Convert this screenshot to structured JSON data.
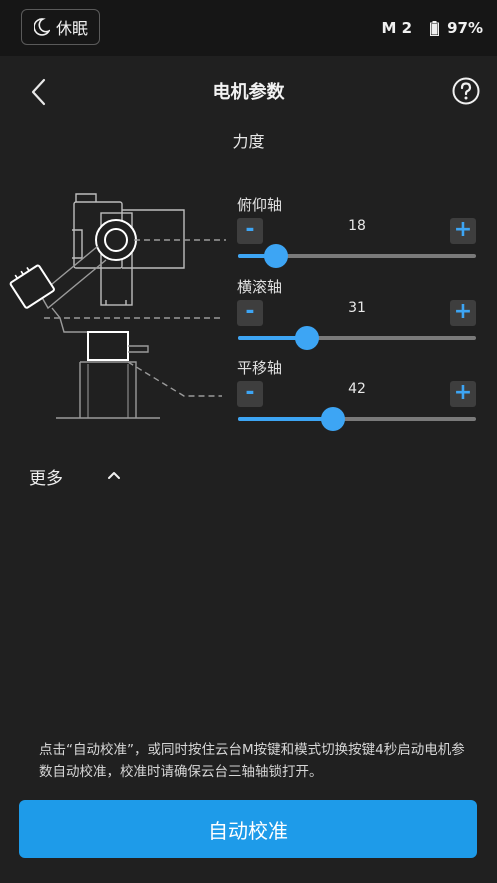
{
  "status_bar": {
    "sleep_label": "休眠",
    "mode": "M 2",
    "battery": "97%"
  },
  "header": {
    "title": "电机参数",
    "subtitle": "力度"
  },
  "axes": [
    {
      "label": "俯仰轴",
      "value": "18",
      "minus": "-",
      "plus": "+",
      "level": 0.16
    },
    {
      "label": "横滚轴",
      "value": "31",
      "minus": "-",
      "plus": "+",
      "level": 0.29
    },
    {
      "label": "平移轴",
      "value": "42",
      "minus": "-",
      "plus": "+",
      "level": 0.4
    }
  ],
  "more_label": "更多",
  "hint": "点击“自动校准”，或同时按住云台M按键和模式切换按键4秒启动电机参数自动校准，校准时请确保云台三轴轴锁打开。",
  "calibrate_button": "自动校准",
  "colors": {
    "accent": "#1e9be9",
    "slider": "#3da5f4",
    "background": "#202020"
  }
}
